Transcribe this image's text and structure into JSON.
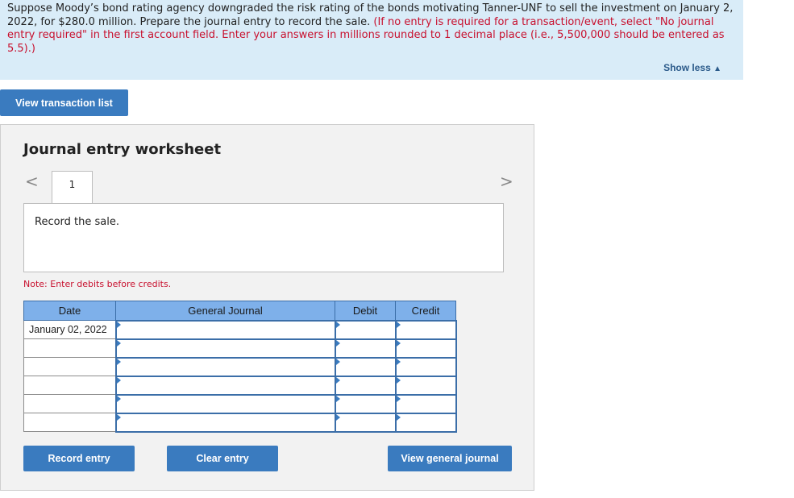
{
  "prompt": {
    "text_main": "Suppose Moody’s bond rating agency downgraded the risk rating of the bonds motivating Tanner-UNF to sell the investment on January 2, 2022, for $280.0 million. Prepare the journal entry to record the sale.",
    "text_instruction": "(If no entry is required for a transaction/event, select \"No journal entry required\" in the first account field. Enter your answers in millions rounded to 1 decimal place (i.e., 5,500,000 should be entered as 5.5).)",
    "show_less_label": "Show less",
    "show_less_icon": "▲"
  },
  "view_transaction_list_label": "View transaction list",
  "worksheet": {
    "title": "Journal entry worksheet",
    "prev_icon": "<",
    "next_icon": ">",
    "tab_label": "1",
    "description": "Record the sale.",
    "note": "Note: Enter debits before credits.",
    "columns": [
      "Date",
      "General Journal",
      "Debit",
      "Credit"
    ],
    "rows": [
      {
        "date": "January 02, 2022",
        "account": "",
        "debit": "",
        "credit": ""
      },
      {
        "date": "",
        "account": "",
        "debit": "",
        "credit": ""
      },
      {
        "date": "",
        "account": "",
        "debit": "",
        "credit": ""
      },
      {
        "date": "",
        "account": "",
        "debit": "",
        "credit": ""
      },
      {
        "date": "",
        "account": "",
        "debit": "",
        "credit": ""
      },
      {
        "date": "",
        "account": "",
        "debit": "",
        "credit": ""
      }
    ],
    "buttons": {
      "record": "Record entry",
      "clear": "Clear entry",
      "view_journal": "View general journal"
    }
  },
  "colors": {
    "prompt_bg": "#d9ecf8",
    "instruction_red": "#c8102e",
    "button_blue": "#3a7bbf",
    "header_blue": "#7eb0ea"
  }
}
